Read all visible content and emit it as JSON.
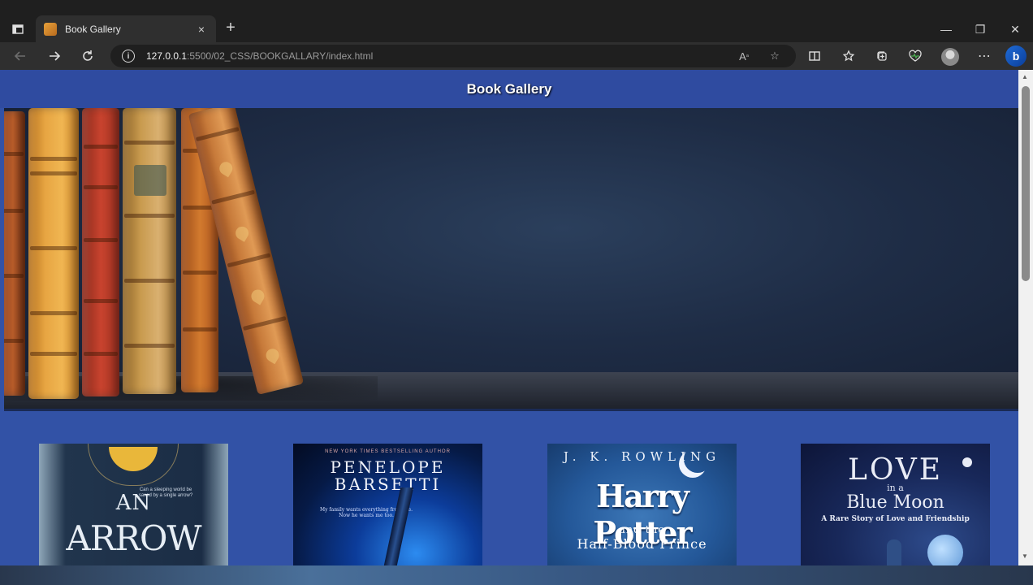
{
  "browser": {
    "tab_title": "Book Gallery",
    "tab_close": "×",
    "new_tab": "+",
    "url_host": "127.0.0.1",
    "url_path": ":5500/02_CSS/BOOKGALLARY/index.html",
    "window_controls": {
      "minimize": "—",
      "restore": "❐",
      "close": "✕"
    },
    "toolbar_icons": [
      "back-icon",
      "forward-icon",
      "refresh-icon",
      "site-info-icon",
      "read-aloud-icon",
      "favorite-star-icon",
      "split-screen-icon",
      "favorites-icon",
      "collections-icon",
      "browser-essentials-icon",
      "profile-icon",
      "more-icon",
      "copilot-icon"
    ]
  },
  "page": {
    "title": "Book Gallery",
    "colors": {
      "header": "#2f4ba0",
      "background": "#3252a6"
    }
  },
  "books": [
    {
      "name": "an-arrow",
      "text_small": "Can a sleeping world be saved by a single arrow?",
      "title_line1": "AN",
      "title_line2": "ARROW"
    },
    {
      "name": "penelope-barsetti",
      "tagline": "NEW YORK TIMES BESTSELLING AUTHOR",
      "author_line1": "PENELOPE",
      "author_line2": "BARSETTI",
      "quote": "My family wants everything from me. Now he wants me too."
    },
    {
      "name": "harry-potter",
      "author": "J. K. ROWLING",
      "title": "Harry Potter",
      "title_and": "and the",
      "subtitle": "Half-Blood Prince"
    },
    {
      "name": "love-in-a-blue-moon",
      "title_love": "LOVE",
      "title_ina": "in a",
      "title_blue": "Blue Moon",
      "subtitle": "A Rare Story of Love and Friendship"
    }
  ]
}
